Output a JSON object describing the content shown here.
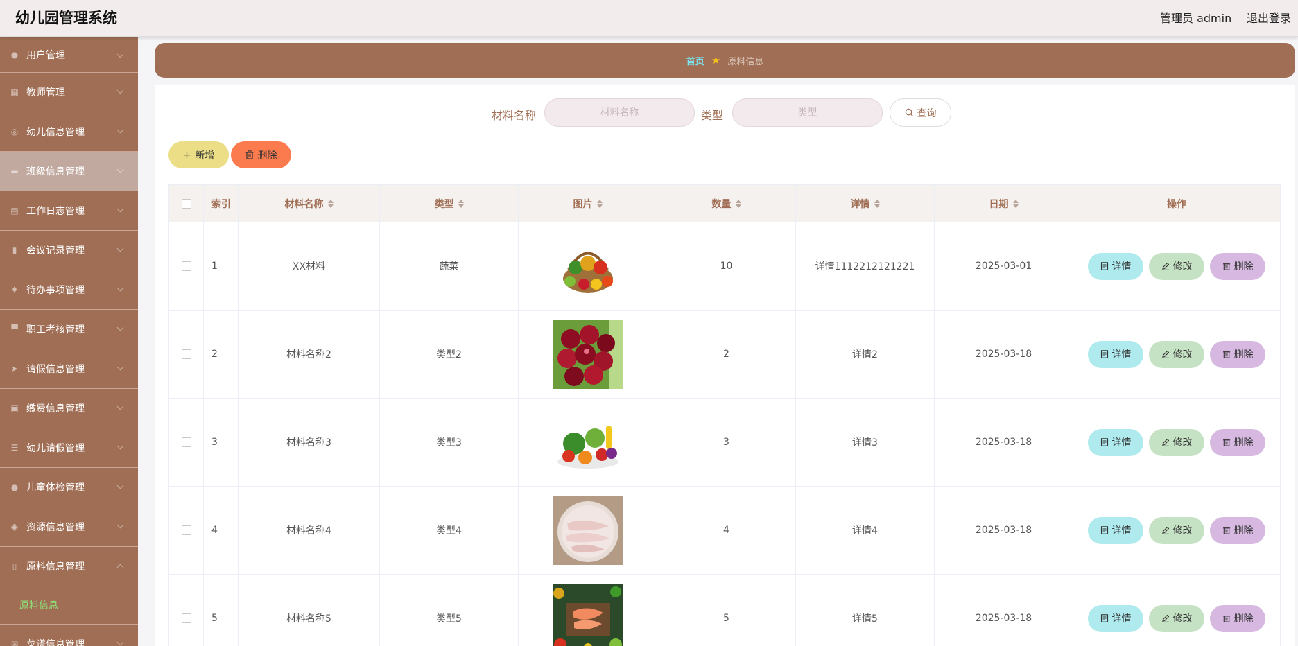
{
  "header": {
    "title": "幼儿园管理系统",
    "admin": "管理员 admin",
    "logout": "退出登录"
  },
  "sidebar": {
    "items": [
      {
        "label": "用户管理",
        "icon": "user-icon"
      },
      {
        "label": "教师管理",
        "icon": "grid-icon"
      },
      {
        "label": "幼儿信息管理",
        "icon": "compass-icon"
      },
      {
        "label": "班级信息管理",
        "icon": "briefcase-icon",
        "active": true
      },
      {
        "label": "工作日志管理",
        "icon": "clipboard-icon"
      },
      {
        "label": "会议记录管理",
        "icon": "bar-chart-icon"
      },
      {
        "label": "待办事项管理",
        "icon": "microphone-icon"
      },
      {
        "label": "职工考核管理",
        "icon": "board-icon"
      },
      {
        "label": "请假信息管理",
        "icon": "send-icon"
      },
      {
        "label": "缴费信息管理",
        "icon": "wallet-icon"
      },
      {
        "label": "幼儿请假管理",
        "icon": "list-icon"
      },
      {
        "label": "儿童体检管理",
        "icon": "person-icon"
      },
      {
        "label": "资源信息管理",
        "icon": "location-icon"
      },
      {
        "label": "原料信息管理",
        "icon": "phone-icon",
        "expanded": true
      },
      {
        "label": "菜谱信息管理",
        "icon": "mail-icon"
      }
    ],
    "sub_item": "原料信息"
  },
  "breadcrumb": {
    "home": "首页",
    "current": "原料信息"
  },
  "search": {
    "name_label": "材料名称",
    "name_placeholder": "材料名称",
    "type_label": "类型",
    "type_placeholder": "类型",
    "query_label": "查询"
  },
  "actions": {
    "add_label": "新增",
    "delete_label": "删除"
  },
  "table": {
    "headers": {
      "index": "索引",
      "name": "材料名称",
      "type": "类型",
      "image": "图片",
      "qty": "数量",
      "detail": "详情",
      "date": "日期",
      "ops": "操作"
    },
    "rows": [
      {
        "index": "1",
        "name": "XX材料",
        "type": "蔬菜",
        "qty": "10",
        "detail": "详情1112212121221",
        "date": "2025-03-01",
        "image": "fruit-basket"
      },
      {
        "index": "2",
        "name": "材料名称2",
        "type": "类型2",
        "qty": "2",
        "detail": "详情2",
        "date": "2025-03-18",
        "image": "cherries"
      },
      {
        "index": "3",
        "name": "材料名称3",
        "type": "类型3",
        "qty": "3",
        "detail": "详情3",
        "date": "2025-03-18",
        "image": "vegetables"
      },
      {
        "index": "4",
        "name": "材料名称4",
        "type": "类型4",
        "qty": "4",
        "detail": "详情4",
        "date": "2025-03-18",
        "image": "pork-trotters"
      },
      {
        "index": "5",
        "name": "材料名称5",
        "type": "类型5",
        "qty": "5",
        "detail": "详情5",
        "date": "2025-03-18",
        "image": "salmon-vegetables"
      }
    ],
    "op_labels": {
      "detail": "详情",
      "edit": "修改",
      "delete": "删除"
    }
  },
  "colors": {
    "brand": "#a06e54",
    "header_bg": "#f3eced",
    "add": "#ebde86",
    "delete": "#fb7a4e",
    "op_detail": "#aeeaee",
    "op_edit": "#c6e2c4",
    "op_delete": "#d6b8e0",
    "active_sub": "#8fe07a",
    "breadcrumb_home": "#7be5ef"
  }
}
